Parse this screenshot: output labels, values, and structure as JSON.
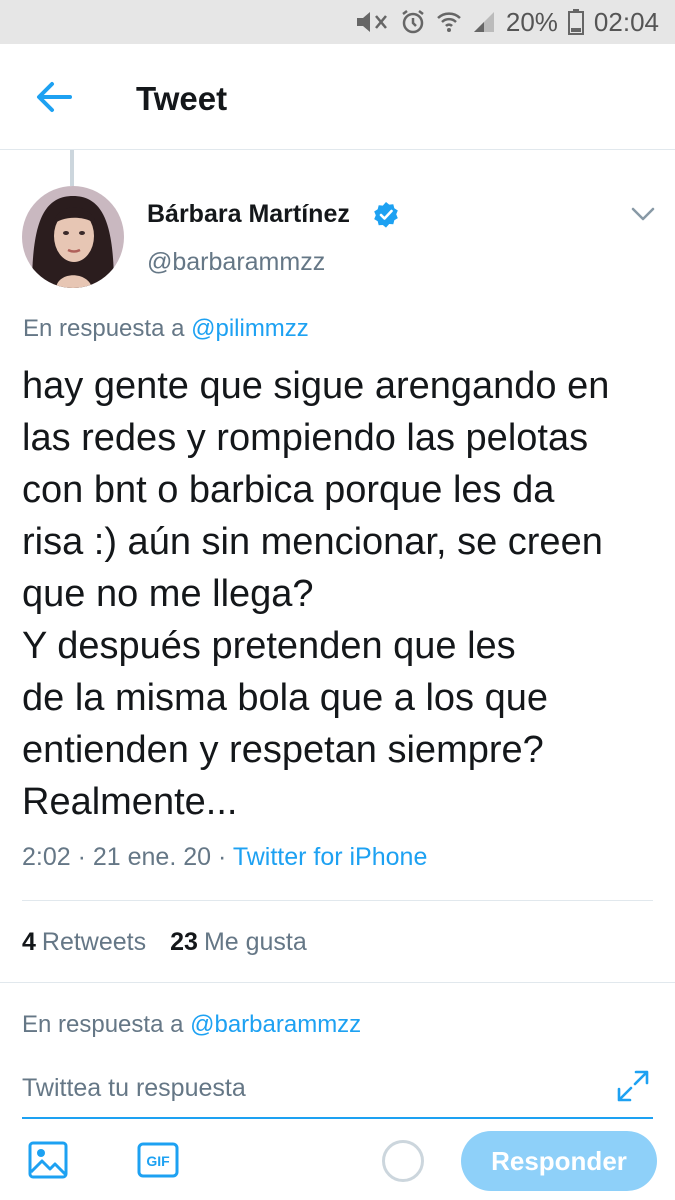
{
  "status_bar": {
    "battery_percent": "20%",
    "time": "02:04",
    "icons": [
      "mute-icon",
      "alarm-icon",
      "wifi-icon",
      "signal-icon",
      "battery-icon"
    ]
  },
  "header": {
    "title": "Tweet",
    "back_icon": "arrow-left-icon"
  },
  "tweet": {
    "author_name": "Bárbara Martínez",
    "verified": true,
    "handle": "@barbarammzz",
    "reply_prefix": "En respuesta a ",
    "reply_mention": "@pilimmzz",
    "text": "hay gente que sigue arengando en\nlas redes y rompiendo las pelotas\ncon bnt o barbica porque les da\nrisa :) aún sin mencionar, se creen\nque no me llega?\nY después pretenden que les\nde la misma bola que a los que\nentienden y respetan siempre?\nRealmente...",
    "timestamp": "2:02 · 21 ene. 20 · ",
    "source": "Twitter for iPhone"
  },
  "stats": {
    "retweets_count": "4",
    "retweets_label": "Retweets",
    "likes_count": "23",
    "likes_label": "Me gusta"
  },
  "composer": {
    "reply_prefix": "En respuesta a ",
    "reply_mention": "@barbarammzz",
    "placeholder": "Twittea tu respuesta",
    "submit_label": "Responder"
  },
  "colors": {
    "accent": "#1da1f2",
    "accent_disabled": "#8ed0f9",
    "secondary_text": "#657786",
    "primary_text": "#14171a",
    "divider": "#e1e8ed",
    "status_bar_bg": "#e6e6e6"
  }
}
